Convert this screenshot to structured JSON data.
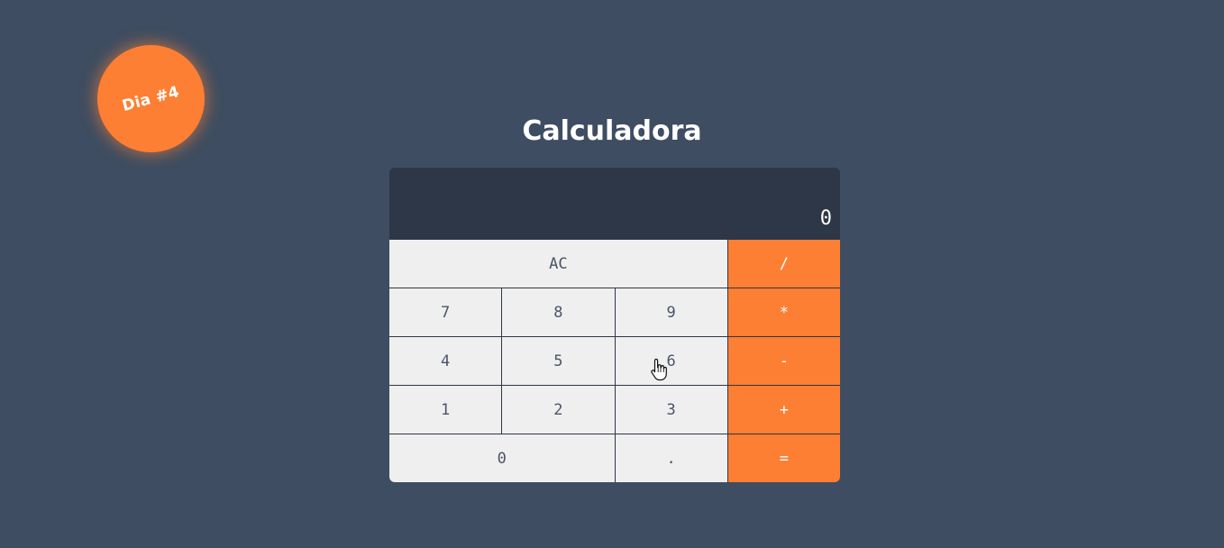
{
  "badge": {
    "label": "Dia #4"
  },
  "title": "Calculadora",
  "display": {
    "value": "0"
  },
  "keys": {
    "clear": "AC",
    "divide": "/",
    "seven": "7",
    "eight": "8",
    "nine": "9",
    "multiply": "*",
    "four": "4",
    "five": "5",
    "six": "6",
    "subtract": "-",
    "one": "1",
    "two": "2",
    "three": "3",
    "add": "+",
    "zero": "0",
    "decimal": ".",
    "equals": "="
  },
  "colors": {
    "background": "#3e4d61",
    "accent": "#fd7f33",
    "display_background": "#2d3748",
    "key_background": "#efefef"
  }
}
